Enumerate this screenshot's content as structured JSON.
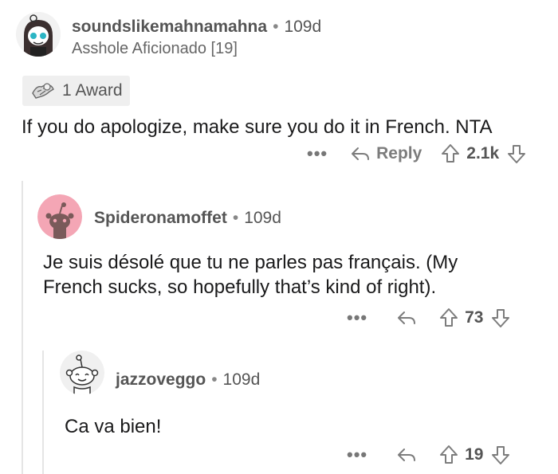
{
  "comments": [
    {
      "username": "soundslikemahnamahna",
      "separator": "•",
      "age": "109d",
      "flair": "Asshole Aficionado [19]",
      "award_count_label": "1 Award",
      "body": "If you do apologize, make sure you do it in French. NTA",
      "more": "•••",
      "reply_label": "Reply",
      "score": "2.1k"
    },
    {
      "username": "Spideronamoffet",
      "separator": "•",
      "age": "109d",
      "body_lines": [
        "Je suis désolé que tu ne parles pas français.  (My",
        "French sucks, so hopefully that’s kind of right)."
      ],
      "more": "•••",
      "score": "73"
    },
    {
      "username": "jazzoveggo",
      "separator": "•",
      "age": "109d",
      "body": "Ca va bien!",
      "more": "•••",
      "score": "19"
    }
  ],
  "colors": {
    "avatar_pink_bg": "#f4a6b5",
    "avatar_gray_bg": "#f0f0f0",
    "meta_text": "#555555",
    "action_icon": "#7c7c7c",
    "thread_line": "#e5e5e5"
  }
}
